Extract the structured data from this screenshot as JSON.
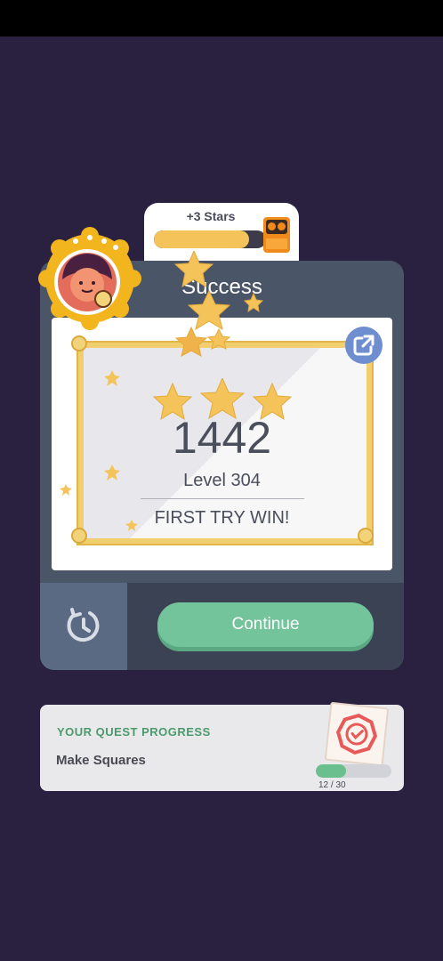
{
  "stars_tab": {
    "label": "+3 Stars",
    "progress": 0.85
  },
  "panel": {
    "title": "Success",
    "score": "1442",
    "level": "Level 304",
    "first_try": "FIRST TRY WIN!",
    "continue_label": "Continue"
  },
  "quest": {
    "title": "YOUR QUEST PROGRESS",
    "name": "Make Squares",
    "count": "12 / 30",
    "progress": 0.4
  },
  "colors": {
    "background": "#2a2140",
    "panel": "#4a5568",
    "continue": "#74c49b",
    "star": "#f4c45a",
    "quest_green": "#4c9a6c"
  }
}
